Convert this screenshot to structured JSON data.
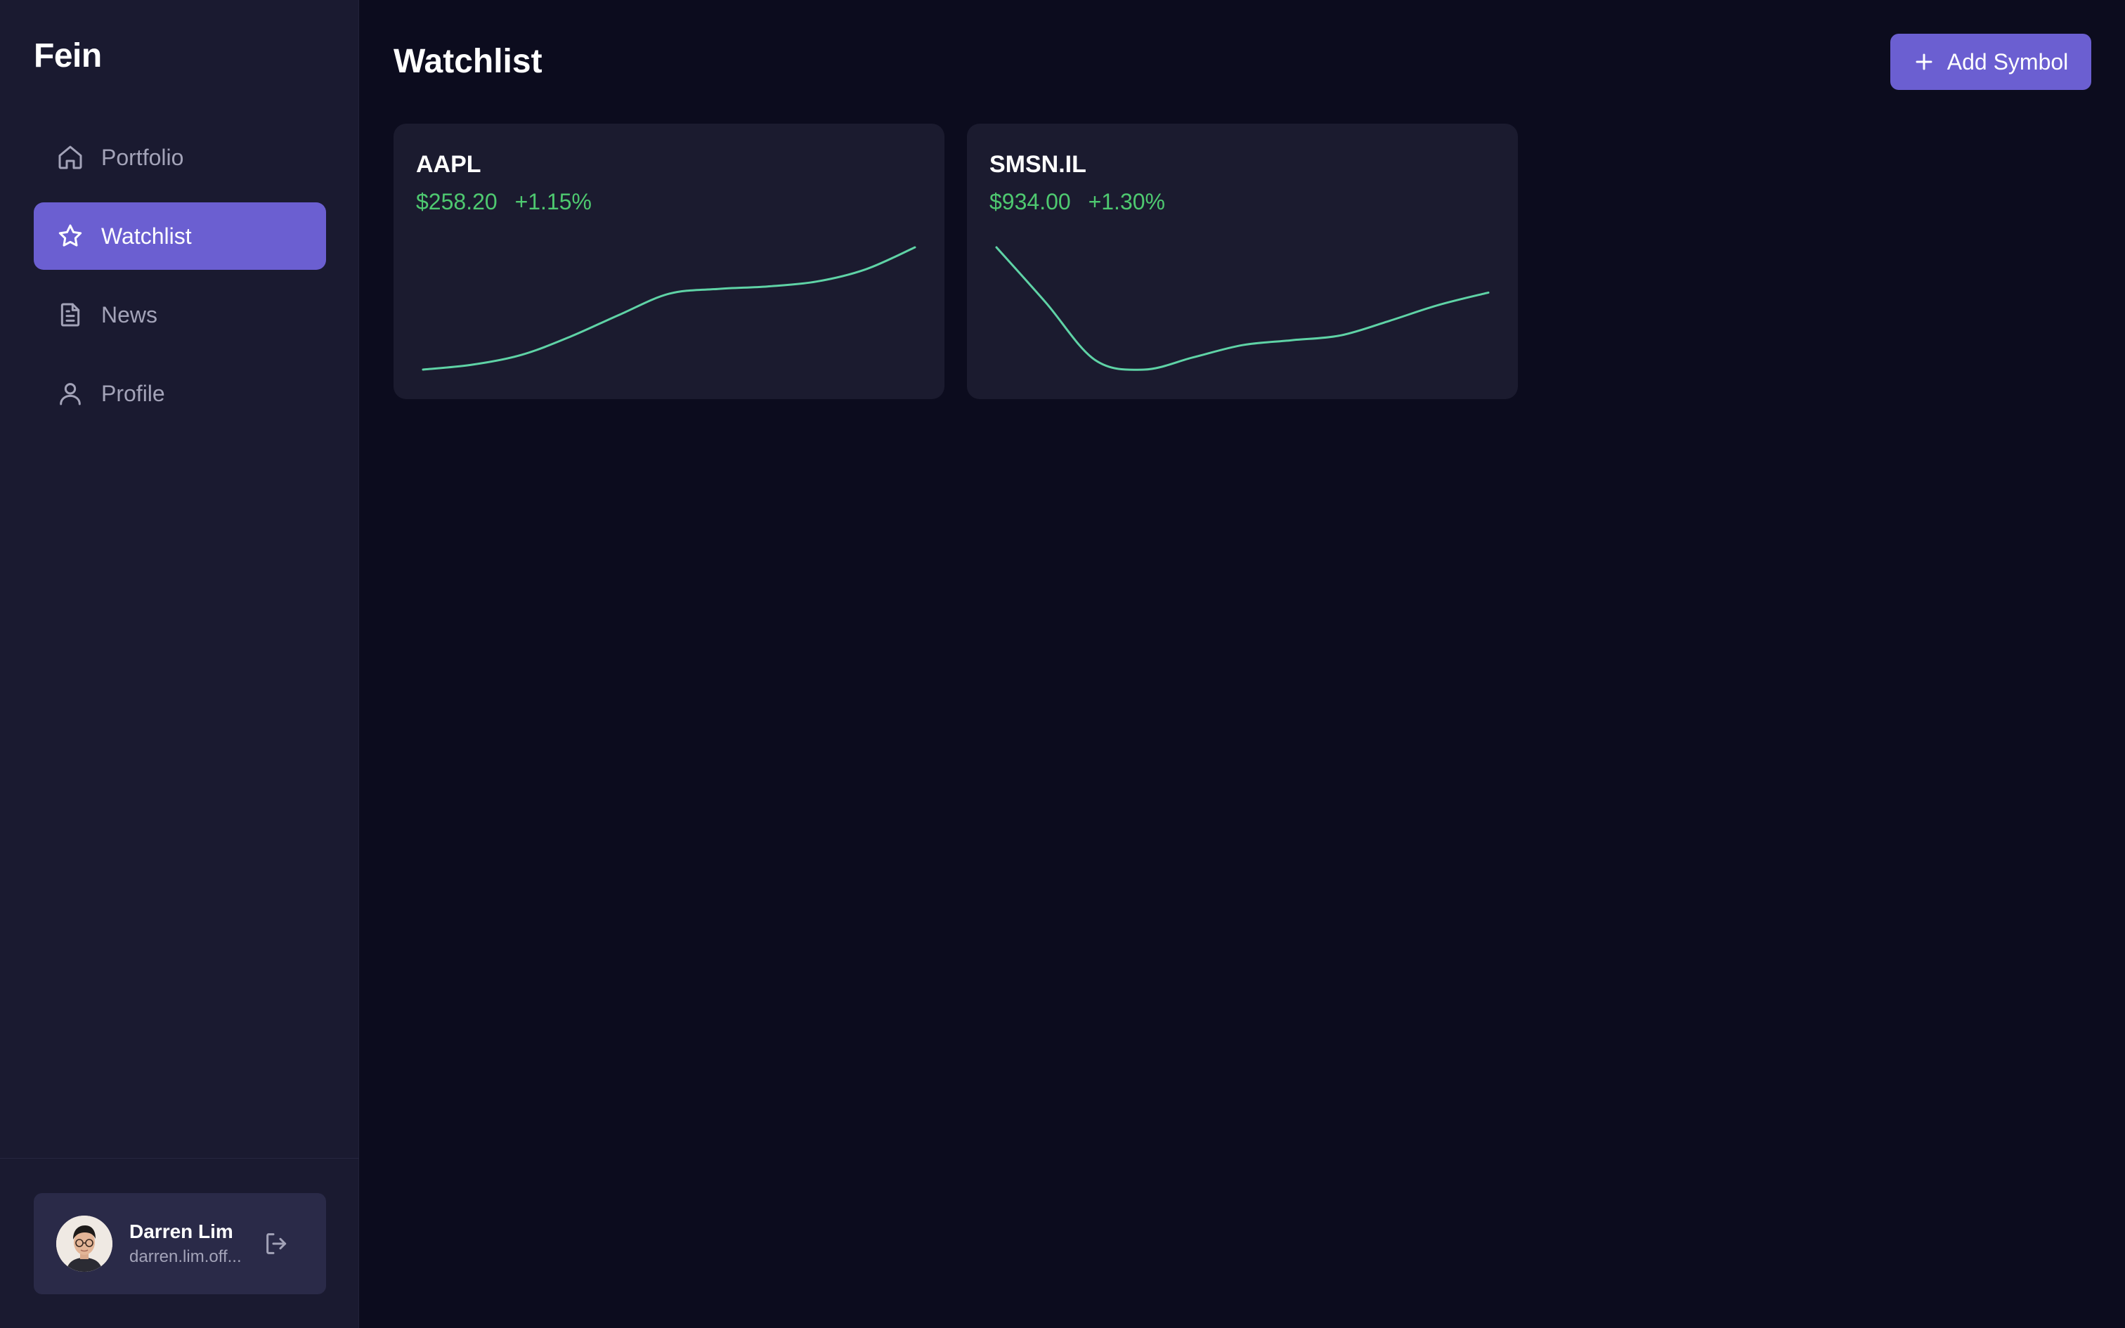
{
  "app": {
    "brand": "Fein"
  },
  "sidebar": {
    "items": [
      {
        "label": "Portfolio",
        "icon": "home-icon",
        "active": false
      },
      {
        "label": "Watchlist",
        "icon": "star-icon",
        "active": true
      },
      {
        "label": "News",
        "icon": "document-icon",
        "active": false
      },
      {
        "label": "Profile",
        "icon": "user-icon",
        "active": false
      }
    ],
    "user": {
      "name": "Darren Lim",
      "email": "darren.lim.off...",
      "logout_icon": "logout-icon"
    }
  },
  "header": {
    "title": "Watchlist",
    "add_button": {
      "label": "Add Symbol",
      "icon": "plus-icon"
    }
  },
  "colors": {
    "background": "#0c0c1e",
    "sidebar": "#1a1a30",
    "accent": "#6b5fd1",
    "positive": "#4ec970",
    "sparkline": "#5fd3a6"
  },
  "watchlist": [
    {
      "symbol": "AAPL",
      "price": "$258.20",
      "change": "+1.15%",
      "trend": [
        0,
        0.04,
        0.12,
        0.27,
        0.45,
        0.62,
        0.66,
        0.68,
        0.72,
        0.82,
        1.0
      ]
    },
    {
      "symbol": "SMSN.IL",
      "price": "$934.00",
      "change": "+1.30%",
      "trend": [
        1.0,
        0.55,
        0.08,
        0.0,
        0.1,
        0.2,
        0.24,
        0.28,
        0.4,
        0.53,
        0.63
      ]
    }
  ]
}
